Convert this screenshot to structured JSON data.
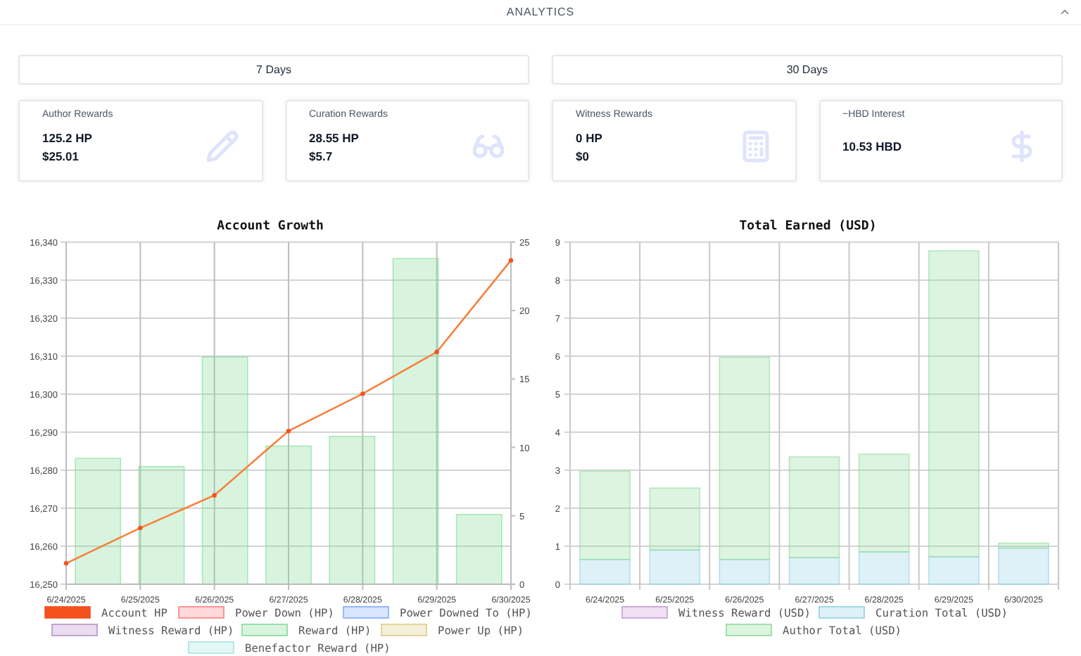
{
  "header": {
    "title": "ANALYTICS"
  },
  "periods": [
    {
      "label": "7 Days"
    },
    {
      "label": "30 Days"
    }
  ],
  "cards": [
    {
      "label": "Author Rewards",
      "values": [
        "125.2 HP",
        "$25.01"
      ]
    },
    {
      "label": "Curation Rewards",
      "values": [
        "28.55 HP",
        "$5.7"
      ]
    },
    {
      "label": "Witness Rewards",
      "values": [
        "0 HP",
        "$0"
      ]
    },
    {
      "label": "~HBD Interest",
      "values": [
        "10.53 HBD"
      ]
    }
  ],
  "charts": [
    {
      "chart_data": {
        "type": "bar",
        "title": "Account Growth",
        "grid": true,
        "legend": true,
        "categories": [
          "6/24/2025",
          "6/25/2025",
          "6/26/2025",
          "6/27/2025",
          "6/28/2025",
          "6/29/2025",
          "6/30/2025"
        ],
        "ylim": [
          16250,
          16340
        ],
        "yticks": [
          {
            "value": 16250,
            "label": "16,250"
          },
          {
            "value": 16260,
            "label": "16,260"
          },
          {
            "value": 16270,
            "label": "16,270"
          },
          {
            "value": 16280,
            "label": "16,280"
          },
          {
            "value": 16290,
            "label": "16,290"
          },
          {
            "value": 16300,
            "label": "16,300"
          },
          {
            "value": 16310,
            "label": "16,310"
          },
          {
            "value": 16320,
            "label": "16,320"
          },
          {
            "value": 16330,
            "label": "16,330"
          },
          {
            "value": 16340,
            "label": "16,340"
          }
        ],
        "y2lim": [
          0,
          25
        ],
        "y2ticks": [
          0,
          5,
          10,
          15,
          20,
          25
        ],
        "series": [
          {
            "name": "Account HP",
            "color": "#f4511e",
            "type": "line",
            "marker": "circle",
            "values": [
              16255.5,
              16264.8,
              16273.4,
              16290.3,
              16300.1,
              16311.1,
              16335.2
            ]
          },
          {
            "name": "Power Down (HP)",
            "color": "#ff8080",
            "type": "bar",
            "axis": "y2",
            "values": [
              null,
              null,
              null,
              null,
              null,
              null,
              null
            ]
          },
          {
            "name": "Power Downed To (HP)",
            "color": "#80aaff",
            "type": "bar",
            "axis": "y2",
            "values": [
              null,
              null,
              null,
              null,
              null,
              null,
              null
            ]
          },
          {
            "name": "Witness Reward (HP)",
            "color": "#b58fc9",
            "type": "bar",
            "axis": "y2",
            "values": [
              null,
              null,
              null,
              null,
              null,
              null,
              null
            ]
          },
          {
            "name": "Reward (HP)",
            "color": "#7fdc95",
            "type": "bar",
            "axis": "y2",
            "values": [
              9.2,
              8.6,
              16.6,
              10.1,
              10.8,
              23.8,
              5.1
            ]
          },
          {
            "name": "Power Up (HP)",
            "color": "#dccb86",
            "type": "bar",
            "axis": "y2",
            "values": [
              null,
              null,
              null,
              null,
              null,
              null,
              null
            ]
          },
          {
            "name": "Benefactor Reward (HP)",
            "color": "#a6e3e3",
            "type": "bar",
            "axis": "y2",
            "values": [
              null,
              null,
              null,
              null,
              null,
              null,
              null
            ]
          }
        ]
      }
    },
    {
      "chart_data": {
        "type": "bar",
        "title": "Total Earned (USD)",
        "stacked": true,
        "grid": true,
        "legend": true,
        "categories": [
          "6/24/2025",
          "6/25/2025",
          "6/26/2025",
          "6/27/2025",
          "6/28/2025",
          "6/29/2025",
          "6/30/2025"
        ],
        "ylim": [
          0,
          9
        ],
        "yticks": [
          0,
          1,
          2,
          3,
          4,
          5,
          6,
          7,
          8,
          9
        ],
        "series": [
          {
            "name": "Witness Reward (USD)",
            "color": "#c99bd6",
            "values": [
              0,
              0,
              0,
              0,
              0,
              0,
              0
            ]
          },
          {
            "name": "Curation Total (USD)",
            "color": "#8fd0e6",
            "values": [
              0.65,
              0.9,
              0.65,
              0.7,
              0.85,
              0.72,
              0.95
            ]
          },
          {
            "name": "Author Total (USD)",
            "color": "#8fdc9a",
            "values": [
              2.32,
              1.63,
              5.32,
              2.65,
              2.57,
              8.05,
              0.13
            ]
          }
        ]
      }
    }
  ]
}
